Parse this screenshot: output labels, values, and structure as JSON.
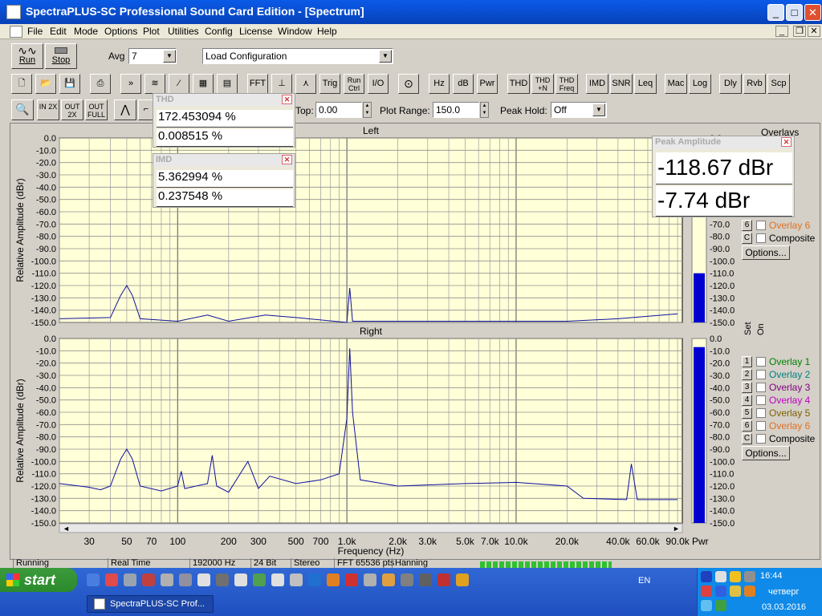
{
  "window": {
    "title": "SpectraPLUS-SC Professional Sound Card Edition - [Spectrum]",
    "min": "_",
    "max": "□",
    "close": "✕"
  },
  "menu": [
    "File",
    "Edit",
    "Mode",
    "Options",
    "Plot",
    "Utilities",
    "Config",
    "License",
    "Window",
    "Help"
  ],
  "toolbar1": {
    "run": "Run",
    "stop": "Stop",
    "avg_label": "Avg",
    "avg_value": "7",
    "config_value": "Load Configuration"
  },
  "toolbar2": {
    "buttons": [
      "FFT",
      "Trig",
      "Run Ctrl",
      "I/O",
      "Hz",
      "dB",
      "Pwr",
      "THD",
      "THD +N",
      "THD Freq",
      "IMD",
      "SNR",
      "Leq",
      "Mac",
      "Log",
      "Dly",
      "Rvb",
      "Scp"
    ]
  },
  "toolbar3": {
    "zoom_in": "IN 2X",
    "zoom_out": "OUT 2X",
    "zoom_full": "OUT FULL",
    "top_label": "Top:",
    "top_value": "0.00",
    "plot_range_label": "Plot Range:",
    "plot_range_value": "150.0",
    "peak_hold_label": "Peak Hold:",
    "peak_hold_value": "Off"
  },
  "thd": {
    "title": "THD",
    "v1": "172.453094 %",
    "v2": "0.008515 %"
  },
  "imd": {
    "title": "IMD",
    "v1": "5.362994 %",
    "v2": "0.237548 %"
  },
  "peak": {
    "title": "Peak Amplitude",
    "v1": "-118.67 dBr",
    "v2": "-7.74 dBr"
  },
  "plot": {
    "left_title": "Left",
    "right_title": "Right",
    "ylabel": "Relative Amplitude (dBr)",
    "xlabel": "Frequency (Hz)",
    "yticks": [
      "0.0",
      "-10.0",
      "-20.0",
      "-30.0",
      "-40.0",
      "-50.0",
      "-60.0",
      "-70.0",
      "-80.0",
      "-90.0",
      "-100.0",
      "-110.0",
      "-120.0",
      "-130.0",
      "-140.0",
      "-150.0"
    ],
    "xticks": [
      "30",
      "50",
      "70",
      "100",
      "200",
      "300",
      "500",
      "700",
      "1.0k",
      "2.0k",
      "3.0k",
      "5.0k",
      "7.0k",
      "10.0k",
      "20.0k",
      "40.0k",
      "60.0k",
      "90.0k"
    ],
    "pwr": "Pwr"
  },
  "chart_data": {
    "type": "line",
    "xscale": "log",
    "xlim": [
      20,
      96000
    ],
    "ylim": [
      -150,
      0
    ],
    "xlabel": "Frequency (Hz)",
    "ylabel": "Relative Amplitude (dBr)",
    "series": [
      {
        "name": "Left",
        "points": [
          [
            20,
            -147
          ],
          [
            40,
            -146
          ],
          [
            46,
            -128
          ],
          [
            50,
            -120
          ],
          [
            54,
            -128
          ],
          [
            60,
            -147
          ],
          [
            100,
            -149
          ],
          [
            150,
            -144
          ],
          [
            200,
            -149
          ],
          [
            330,
            -144
          ],
          [
            500,
            -146
          ],
          [
            1000,
            -150
          ],
          [
            1040,
            -122
          ],
          [
            1080,
            -149
          ],
          [
            3000,
            -149
          ],
          [
            10000,
            -149
          ],
          [
            20000,
            -149
          ],
          [
            40000,
            -147
          ],
          [
            90000,
            -143
          ]
        ]
      },
      {
        "name": "Right",
        "points": [
          [
            20,
            -118
          ],
          [
            30,
            -121
          ],
          [
            35,
            -123
          ],
          [
            40,
            -120
          ],
          [
            46,
            -98
          ],
          [
            50,
            -90
          ],
          [
            54,
            -98
          ],
          [
            60,
            -120
          ],
          [
            80,
            -124
          ],
          [
            100,
            -120
          ],
          [
            105,
            -108
          ],
          [
            110,
            -122
          ],
          [
            150,
            -118
          ],
          [
            160,
            -95
          ],
          [
            170,
            -120
          ],
          [
            200,
            -125
          ],
          [
            260,
            -100
          ],
          [
            300,
            -122
          ],
          [
            350,
            -112
          ],
          [
            500,
            -118
          ],
          [
            700,
            -115
          ],
          [
            900,
            -110
          ],
          [
            1000,
            -65
          ],
          [
            1040,
            -8
          ],
          [
            1080,
            -60
          ],
          [
            1200,
            -115
          ],
          [
            2000,
            -120
          ],
          [
            5000,
            -118
          ],
          [
            10000,
            -117
          ],
          [
            20000,
            -120
          ],
          [
            25000,
            -130
          ],
          [
            45000,
            -131
          ],
          [
            48000,
            -102
          ],
          [
            52000,
            -131
          ],
          [
            90000,
            -131
          ]
        ]
      }
    ]
  },
  "right_panel": {
    "overlays_title": "Overlays",
    "set": "Set",
    "on": "On",
    "items": [
      {
        "num": "1",
        "label": "Overlay 1",
        "color": "#008000"
      },
      {
        "num": "2",
        "label": "Overlay 2",
        "color": "#008080"
      },
      {
        "num": "3",
        "label": "Overlay 3",
        "color": "#800080"
      },
      {
        "num": "4",
        "label": "Overlay 4",
        "color": "#c000c0"
      },
      {
        "num": "5",
        "label": "Overlay 5",
        "color": "#806000"
      },
      {
        "num": "6",
        "label": "Overlay 6",
        "color": "#e07020"
      },
      {
        "num": "C",
        "label": "Composite",
        "color": "#000000"
      }
    ],
    "options": "Options...",
    "left_level": -110,
    "right_level": -7
  },
  "status": [
    "Running",
    "Real Time",
    "192000 Hz",
    "24 Bit",
    "Stereo",
    "FFT 65536 pts",
    "Hanning"
  ],
  "taskbar": {
    "start": "start",
    "task": "SpectraPLUS-SC Prof...",
    "lang": "EN",
    "time": "16:44",
    "day": "четверг",
    "date": "03.03.2016"
  }
}
